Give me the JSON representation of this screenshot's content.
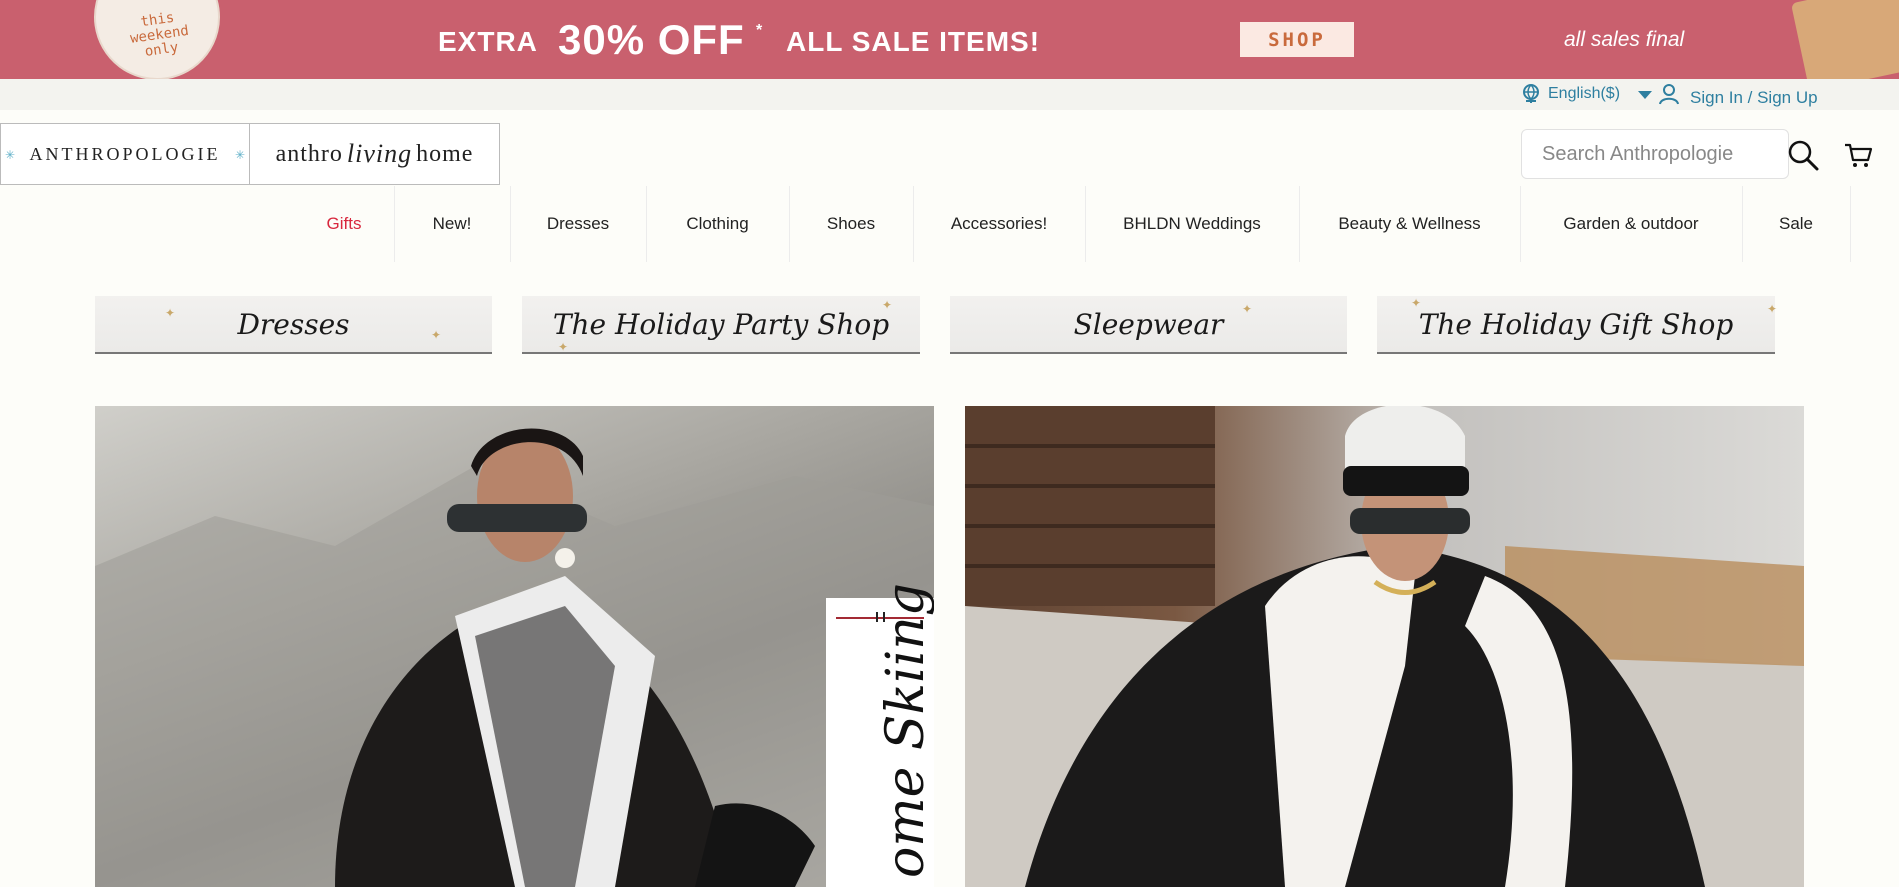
{
  "promo": {
    "badge_lines": [
      "this",
      "weekend",
      "only"
    ],
    "extra": "EXTRA",
    "percent": "30% OFF",
    "asterisk": "*",
    "all_sale": "ALL SALE ITEMS!",
    "shop_label": "SHOP",
    "all_sales_final": "all sales final"
  },
  "utility": {
    "language": "English($)",
    "sign_in": "Sign In / Sign Up"
  },
  "logos": {
    "anthropologie": "ANTHROPOLOGIE",
    "living_left": "anthro",
    "living_script": "living",
    "living_right": "home"
  },
  "search": {
    "placeholder": "Search Anthropologie"
  },
  "nav": {
    "items": [
      "Gifts",
      "New!",
      "Dresses",
      "Clothing",
      "Shoes",
      "Accessories!",
      "BHLDN Weddings",
      "Beauty & Wellness",
      "Garden & outdoor",
      "Sale"
    ]
  },
  "shop_buttons": [
    "Dresses",
    "The Holiday Party Shop",
    "Sleepwear",
    "The Holiday Gift Shop"
  ],
  "hero": {
    "left_card_text": "ome Skiing"
  },
  "colors": {
    "promo_bg": "#c9606e",
    "link_blue": "#2e7fa0",
    "nav_active": "#d8283e",
    "page_bg": "#fdfdf9"
  }
}
